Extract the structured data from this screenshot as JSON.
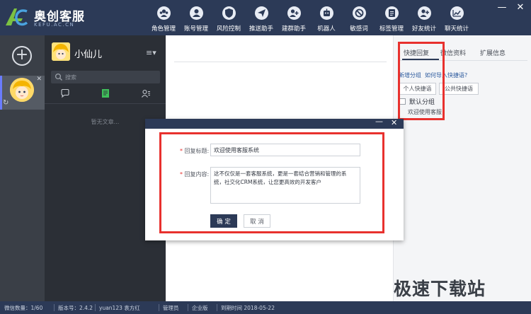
{
  "app": {
    "title": "奥创客服",
    "subtitle": "KEFU.AC.CN",
    "brand_color": "#2c3a57",
    "highlight_color": "#e8312e"
  },
  "nav": {
    "items": [
      {
        "label": "角色管理",
        "icon": "user-group-icon"
      },
      {
        "label": "账号管理",
        "icon": "account-icon"
      },
      {
        "label": "风险控制",
        "icon": "shield-icon"
      },
      {
        "label": "推送助手",
        "icon": "send-icon"
      },
      {
        "label": "建群助手",
        "icon": "group-add-icon"
      },
      {
        "label": "机器人",
        "icon": "robot-icon"
      },
      {
        "label": "敏感词",
        "icon": "forbidden-icon"
      },
      {
        "label": "标签管理",
        "icon": "tag-icon"
      },
      {
        "label": "好友统计",
        "icon": "friends-stats-icon"
      },
      {
        "label": "聊天统计",
        "icon": "chat-stats-icon"
      }
    ]
  },
  "window": {
    "minimize": "—",
    "close": "✕"
  },
  "leftcol": {
    "add": "+",
    "account_close": "✕",
    "sync": "↻"
  },
  "listcol": {
    "user_name": "小仙儿",
    "menu": "≡▾",
    "search_placeholder": "搜索",
    "empty_text": "暂无文章..."
  },
  "rightpanel": {
    "tabs": [
      "快捷回复",
      "微信资料",
      "扩展信息"
    ],
    "add_group": "新增分组",
    "import": "如何导入快捷语?",
    "type_buttons": [
      "个人快捷语",
      "公共快捷语"
    ],
    "group_label": "默认分组",
    "item": "欢迎使用客服"
  },
  "modal": {
    "minimize": "—",
    "close": "✕",
    "req_mark": "*",
    "title_label": "回复标题:",
    "title_value": "欢迎使用客服系统",
    "content_label": "回复内容:",
    "content_value": "这不仅仅是一套客服系统，更是一套结合营销和管理的系统，社交化CRM系统，让您更高效的开发客户",
    "confirm": "确 定",
    "cancel": "取 消"
  },
  "statusbar": {
    "items": [
      "微信数量：1/60",
      "版本号：2.4.2",
      "yuan123 袁方红",
      "管理员",
      "企业版",
      "到期时间 2018-05-22"
    ]
  },
  "watermark": "极速下载站"
}
